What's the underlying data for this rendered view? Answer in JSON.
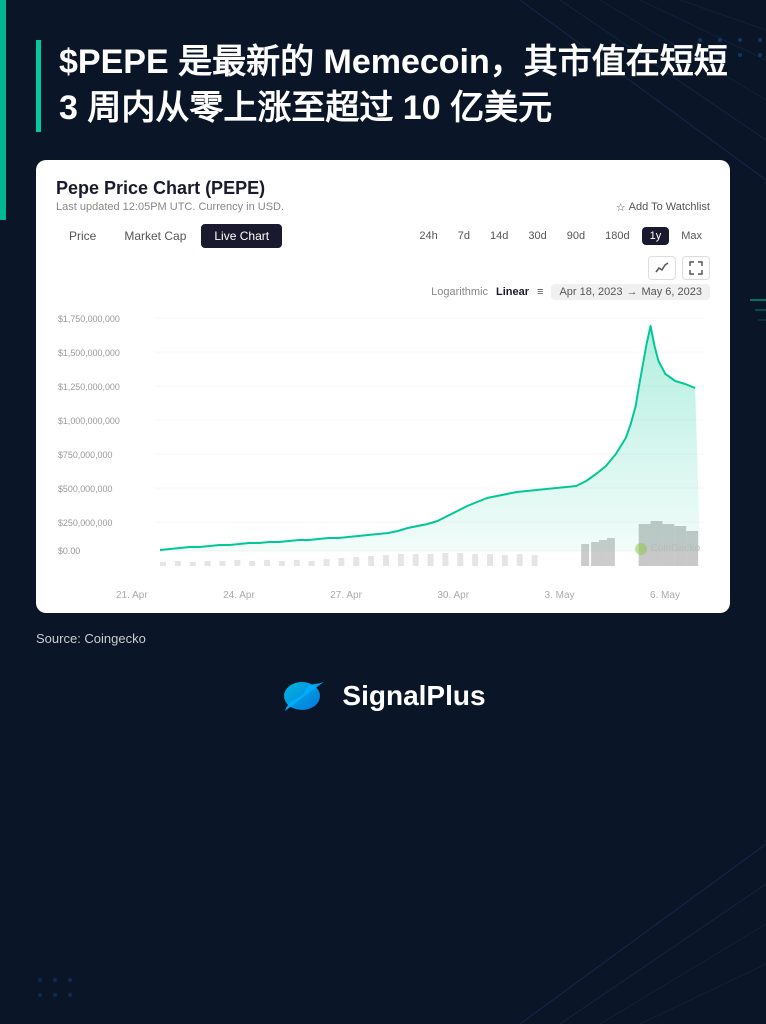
{
  "background": {
    "color": "#0a1628"
  },
  "headline": {
    "text": "$PEPE 是最新的 Memecoin，其市值在短短 3 周内从零上涨至超过 10 亿美元"
  },
  "chart": {
    "title": "Pepe Price Chart (PEPE)",
    "subtitle": "Last updated 12:05PM UTC. Currency in USD.",
    "watchlist_label": "Add To Watchlist",
    "tabs_left": [
      "Price",
      "Market Cap",
      "Live Chart"
    ],
    "active_tab_left": "Live Chart",
    "tabs_right": [
      "24h",
      "7d",
      "14d",
      "30d",
      "90d",
      "180d",
      "1y",
      "Max"
    ],
    "active_tab_right": "1y",
    "scale_options": [
      "Logarithmic",
      "Linear"
    ],
    "active_scale": "Linear",
    "date_range_start": "Apr 18, 2023",
    "date_range_end": "May 6, 2023",
    "y_axis_labels": [
      "$1,750,000,000",
      "$1,500,000,000",
      "$1,250,000,000",
      "$1,000,000,000",
      "$750,000,000",
      "$500,000,000",
      "$250,000,000",
      "$0.00"
    ],
    "x_axis_labels": [
      "21. Apr",
      "24. Apr",
      "27. Apr",
      "30. Apr",
      "3. May",
      "6. May"
    ],
    "watermark": "CoinGecko"
  },
  "source": {
    "text": "Source: Coingecko"
  },
  "logo": {
    "text": "SignalPlus"
  },
  "icons": {
    "star": "☆",
    "arrow_right": "→",
    "line_chart": "↗",
    "fullscreen": "⛶",
    "menu": "≡"
  }
}
